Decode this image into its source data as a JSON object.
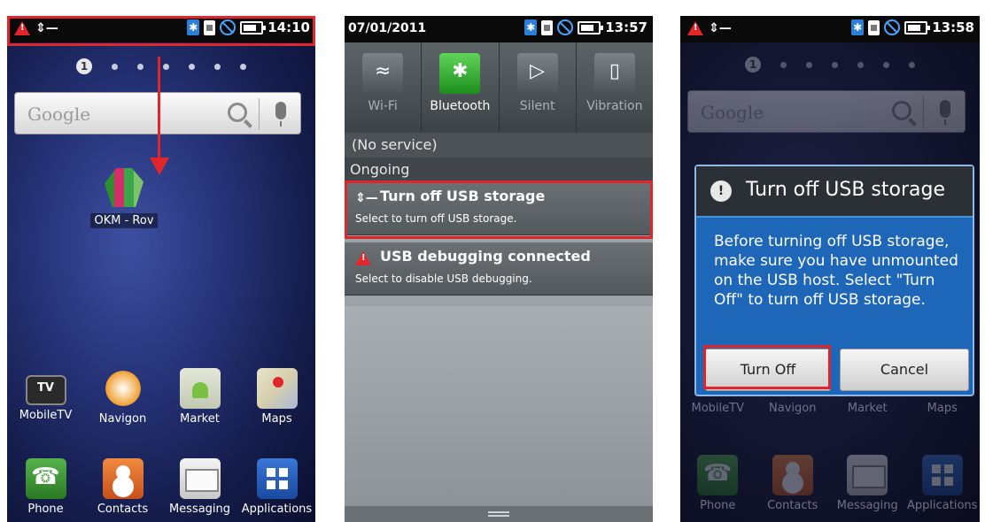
{
  "screen1": {
    "time": "14:10",
    "search_placeholder": "Google",
    "page_indicator": "1",
    "widget_label": "OKM - Rov",
    "apps_row1": [
      "MobileTV",
      "Navigon",
      "Market",
      "Maps"
    ],
    "apps_row2": [
      "Phone",
      "Contacts",
      "Messaging",
      "Applications"
    ],
    "tv_icon_text": "TV"
  },
  "screen2": {
    "date": "07/01/2011",
    "time": "13:57",
    "quick_settings": [
      "Wi-Fi",
      "Bluetooth",
      "Silent",
      "Vibration"
    ],
    "no_service": "(No service)",
    "section_ongoing": "Ongoing",
    "notif_usb_title": "Turn off USB storage",
    "notif_usb_sub": "Select to turn off USB storage.",
    "notif_debug_title": "USB debugging connected",
    "notif_debug_sub": "Select to disable USB debugging."
  },
  "screen3": {
    "time": "13:58",
    "search_placeholder": "Google",
    "page_indicator": "1",
    "dialog_title": "Turn off USB storage",
    "dialog_body": "Before turning off USB storage, make sure you have unmounted on the USB host. Select \"Turn Off\" to turn off USB storage.",
    "btn_turn_off": "Turn Off",
    "btn_cancel": "Cancel",
    "apps_row1": [
      "MobileTV",
      "Navigon",
      "Market",
      "Maps"
    ],
    "apps_row2": [
      "Phone",
      "Contacts",
      "Messaging",
      "Applications"
    ]
  },
  "colors": {
    "highlight": "#e0262a",
    "dialog_blue": "#1d66b8",
    "bluetooth_on": "#1d8e1d"
  },
  "icons": {
    "warning": "warning-icon",
    "usb": "usb-icon",
    "bluetooth": "bluetooth-icon",
    "sim": "sim-icon",
    "no_signal": "no-signal-icon",
    "battery": "battery-icon"
  }
}
